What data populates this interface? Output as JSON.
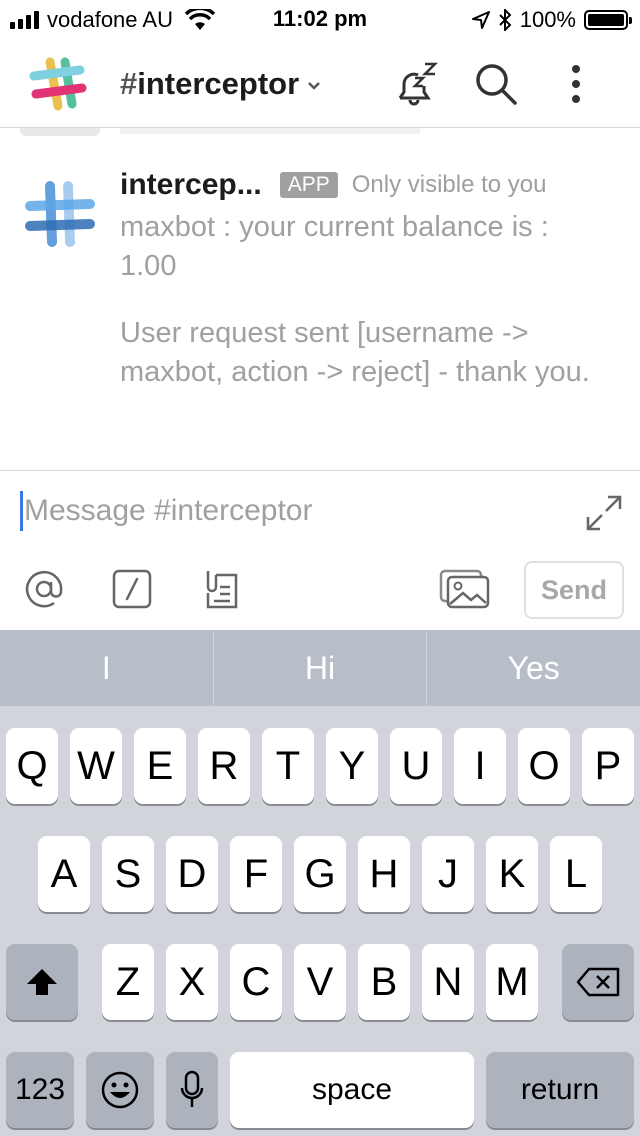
{
  "status_bar": {
    "carrier": "vodafone AU",
    "time": "11:02 pm",
    "battery": "100%"
  },
  "header": {
    "channel_hash": "#",
    "channel_name": "interceptor"
  },
  "message": {
    "sender": "intercep...",
    "badge": "APP",
    "visibility": "Only visible to you",
    "lines": [
      "maxbot : your current balance is : 1.00",
      "User request sent [username -> maxbot, action -> reject] - thank you."
    ]
  },
  "composer": {
    "placeholder": "Message #interceptor",
    "send_label": "Send"
  },
  "keyboard": {
    "suggestions": [
      "I",
      "Hi",
      "Yes"
    ],
    "row1": [
      "Q",
      "W",
      "E",
      "R",
      "T",
      "Y",
      "U",
      "I",
      "O",
      "P"
    ],
    "row2": [
      "A",
      "S",
      "D",
      "F",
      "G",
      "H",
      "J",
      "K",
      "L"
    ],
    "row3": [
      "Z",
      "X",
      "C",
      "V",
      "B",
      "N",
      "M"
    ],
    "numbers_label": "123",
    "space_label": "space",
    "return_label": "return"
  },
  "colors": {
    "accent_cursor": "#3b78e7",
    "muted_text": "#a0a0a0",
    "keyboard_bg": "#d1d4da",
    "suggest_bg": "#b8bec7"
  },
  "icons": {
    "header": [
      "slack-logo-icon",
      "snooze-bell-icon",
      "search-icon",
      "more-vertical-icon"
    ],
    "composer": [
      "at-mention-icon",
      "slash-command-icon",
      "attach-file-icon",
      "image-upload-icon",
      "expand-icon"
    ],
    "keyboard": [
      "shift-icon",
      "backspace-icon",
      "emoji-icon",
      "microphone-icon"
    ]
  }
}
